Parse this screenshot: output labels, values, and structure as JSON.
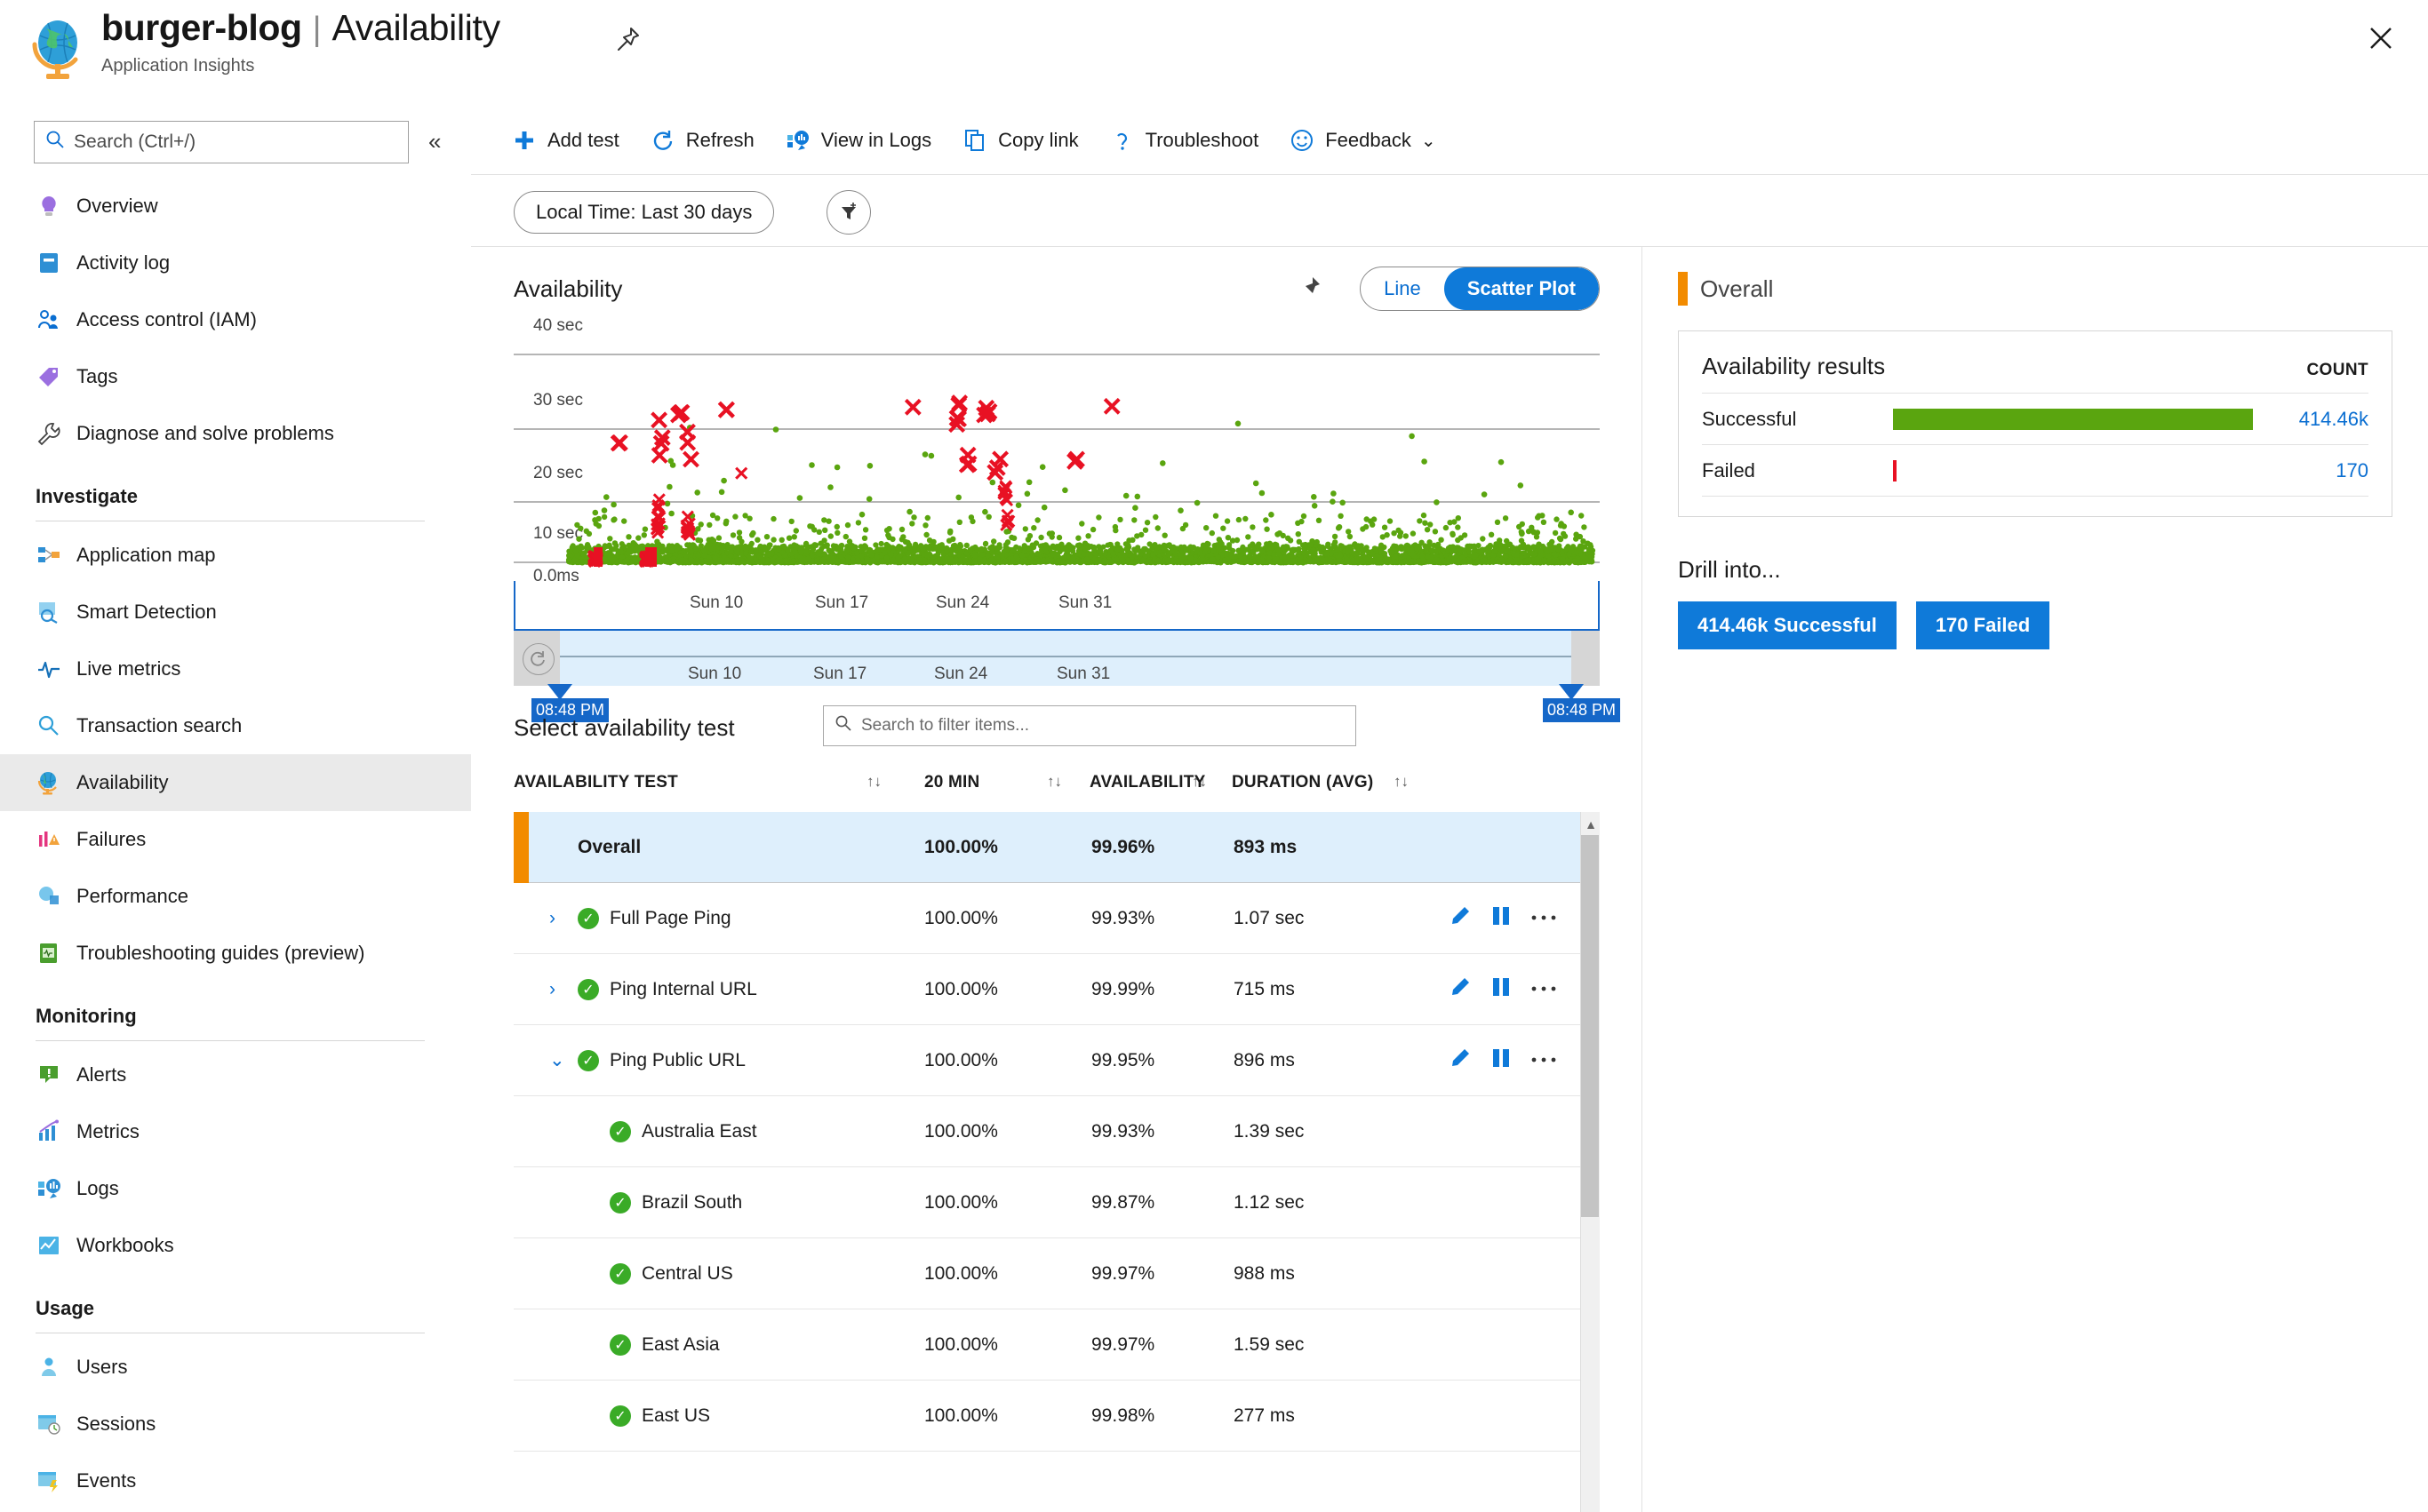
{
  "header": {
    "resource_name": "burger-blog",
    "separator": "|",
    "page_name": "Availability",
    "subtitle": "Application Insights",
    "pin_icon": "pin-icon",
    "close_icon": "close-icon",
    "globe_icon": "globe-icon"
  },
  "sidebar": {
    "search_placeholder": "Search (Ctrl+/)",
    "search_icon": "search-icon",
    "collapse_icon": "double-chevron-left-icon",
    "items": [
      {
        "label": "Overview",
        "icon": "lightbulb-icon",
        "active": false
      },
      {
        "label": "Activity log",
        "icon": "activity-log-icon",
        "active": false
      },
      {
        "label": "Access control (IAM)",
        "icon": "people-icon",
        "active": false
      },
      {
        "label": "Tags",
        "icon": "tag-icon",
        "active": false
      },
      {
        "label": "Diagnose and solve problems",
        "icon": "wrench-icon",
        "active": false
      }
    ],
    "sections": [
      {
        "title": "Investigate",
        "items": [
          {
            "label": "Application map",
            "icon": "application-map-icon",
            "active": false
          },
          {
            "label": "Smart Detection",
            "icon": "smart-detection-icon",
            "active": false
          },
          {
            "label": "Live metrics",
            "icon": "pulse-icon",
            "active": false
          },
          {
            "label": "Transaction search",
            "icon": "magnifier-icon",
            "active": false
          },
          {
            "label": "Availability",
            "icon": "globe-icon",
            "active": true
          },
          {
            "label": "Failures",
            "icon": "failures-icon",
            "active": false
          },
          {
            "label": "Performance",
            "icon": "performance-icon",
            "active": false
          },
          {
            "label": "Troubleshooting guides (preview)",
            "icon": "guide-book-icon",
            "active": false
          }
        ]
      },
      {
        "title": "Monitoring",
        "items": [
          {
            "label": "Alerts",
            "icon": "alert-icon",
            "active": false
          },
          {
            "label": "Metrics",
            "icon": "metrics-chart-icon",
            "active": false
          },
          {
            "label": "Logs",
            "icon": "logs-icon",
            "active": false
          },
          {
            "label": "Workbooks",
            "icon": "workbooks-icon",
            "active": false
          }
        ]
      },
      {
        "title": "Usage",
        "items": [
          {
            "label": "Users",
            "icon": "user-icon",
            "active": false
          },
          {
            "label": "Sessions",
            "icon": "sessions-icon",
            "active": false
          },
          {
            "label": "Events",
            "icon": "events-icon",
            "active": false
          }
        ]
      }
    ]
  },
  "command_bar": {
    "items": [
      {
        "label": "Add test",
        "icon": "plus-icon"
      },
      {
        "label": "Refresh",
        "icon": "refresh-icon"
      },
      {
        "label": "View in Logs",
        "icon": "logs-icon"
      },
      {
        "label": "Copy link",
        "icon": "copy-icon"
      },
      {
        "label": "Troubleshoot",
        "icon": "question-mark-icon"
      },
      {
        "label": "Feedback",
        "icon": "smiley-icon",
        "chevron": "chevron-down-icon"
      }
    ]
  },
  "filter_bar": {
    "time_range": "Local Time: Last 30 days",
    "add_filter_icon": "add-filter-icon"
  },
  "chart_panel": {
    "title": "Availability",
    "pin_icon": "pin-icon",
    "view_toggle": {
      "options": [
        "Line",
        "Scatter Plot"
      ],
      "selected": "Scatter Plot"
    }
  },
  "chart_data": {
    "type": "scatter",
    "title": "Availability",
    "xlabel": "",
    "ylabel": "",
    "ylim": [
      0,
      40
    ],
    "y_tick_labels": [
      "40 sec",
      "30 sec",
      "20 sec",
      "10 sec",
      "0.0ms"
    ],
    "y_tick_values": [
      40,
      30,
      20,
      10,
      0
    ],
    "x_tick_labels": [
      "Sun 10",
      "Sun 17",
      "Sun 24",
      "Sun 31"
    ],
    "grid": true,
    "legend_position": "none",
    "series": [
      {
        "name": "Successful",
        "marker": "dot",
        "color": "#5aa50f",
        "count": 414460,
        "note": "Dense band of successful test results concentrated near 0-2 sec across the full 30-day window, with scattered outliers up to ~30 sec"
      },
      {
        "name": "Failed",
        "marker": "cross",
        "color": "#e81123",
        "count": 170,
        "note": "Red X markers clustered at several incident times, spanning 0 sec to ~30 sec"
      }
    ]
  },
  "time_slider": {
    "start_label": "08:48 PM",
    "end_label": "08:48 PM",
    "x_tick_labels": [
      "Sun 10",
      "Sun 17",
      "Sun 24",
      "Sun 31"
    ],
    "reset_icon": "reset-icon"
  },
  "test_table": {
    "title": "Select availability test",
    "search_placeholder": "Search to filter items...",
    "search_icon": "search-icon",
    "columns": [
      {
        "label": "AVAILABILITY TEST",
        "sortable": true
      },
      {
        "label": "20 MIN",
        "sortable": true
      },
      {
        "label": "AVAILABILITY",
        "sortable": true
      },
      {
        "label": "DURATION (AVG)",
        "sortable": true
      }
    ],
    "sort_icon": "sort-arrows-icon",
    "rows": [
      {
        "name": "Overall",
        "twenty_min": "100.00%",
        "availability": "99.96%",
        "duration": "893 ms",
        "level": 0,
        "selected": true,
        "bold": true,
        "status": null,
        "expander": null,
        "actions": false
      },
      {
        "name": "Full Page Ping",
        "twenty_min": "100.00%",
        "availability": "99.93%",
        "duration": "1.07 sec",
        "level": 1,
        "selected": false,
        "bold": false,
        "status": "success",
        "expander": "collapsed",
        "actions": true
      },
      {
        "name": "Ping Internal URL",
        "twenty_min": "100.00%",
        "availability": "99.99%",
        "duration": "715 ms",
        "level": 1,
        "selected": false,
        "bold": false,
        "status": "success",
        "expander": "collapsed",
        "actions": true
      },
      {
        "name": "Ping Public URL",
        "twenty_min": "100.00%",
        "availability": "99.95%",
        "duration": "896 ms",
        "level": 1,
        "selected": false,
        "bold": false,
        "status": "success",
        "expander": "expanded",
        "actions": true
      },
      {
        "name": "Australia East",
        "twenty_min": "100.00%",
        "availability": "99.93%",
        "duration": "1.39 sec",
        "level": 2,
        "selected": false,
        "bold": false,
        "status": "success",
        "expander": null,
        "actions": false
      },
      {
        "name": "Brazil South",
        "twenty_min": "100.00%",
        "availability": "99.87%",
        "duration": "1.12 sec",
        "level": 2,
        "selected": false,
        "bold": false,
        "status": "success",
        "expander": null,
        "actions": false
      },
      {
        "name": "Central US",
        "twenty_min": "100.00%",
        "availability": "99.97%",
        "duration": "988 ms",
        "level": 2,
        "selected": false,
        "bold": false,
        "status": "success",
        "expander": null,
        "actions": false
      },
      {
        "name": "East Asia",
        "twenty_min": "100.00%",
        "availability": "99.97%",
        "duration": "1.59 sec",
        "level": 2,
        "selected": false,
        "bold": false,
        "status": "success",
        "expander": null,
        "actions": false
      },
      {
        "name": "East US",
        "twenty_min": "100.00%",
        "availability": "99.98%",
        "duration": "277 ms",
        "level": 2,
        "selected": false,
        "bold": false,
        "status": "success",
        "expander": null,
        "actions": false
      }
    ],
    "row_action_icons": [
      "pencil-icon",
      "pause-icon",
      "more-ellipsis-icon"
    ]
  },
  "right_panel": {
    "overall_label": "Overall",
    "card_title": "Availability results",
    "count_header": "COUNT",
    "results": [
      {
        "label": "Successful",
        "value": "414.46k",
        "bar_pct": 100,
        "color": "#5aa50f"
      },
      {
        "label": "Failed",
        "value": "170",
        "bar_pct": 0.5,
        "color": "#e81123"
      }
    ],
    "drill_title": "Drill into...",
    "drill_buttons": [
      {
        "label": "414.46k Successful"
      },
      {
        "label": "170 Failed"
      }
    ]
  },
  "colors": {
    "accent_blue": "#0f7ad9",
    "link_blue": "#0a6ed1",
    "success_green": "#5aa50f",
    "fail_red": "#e81123",
    "orange": "#f28b00",
    "selected_row": "#deeffc"
  }
}
